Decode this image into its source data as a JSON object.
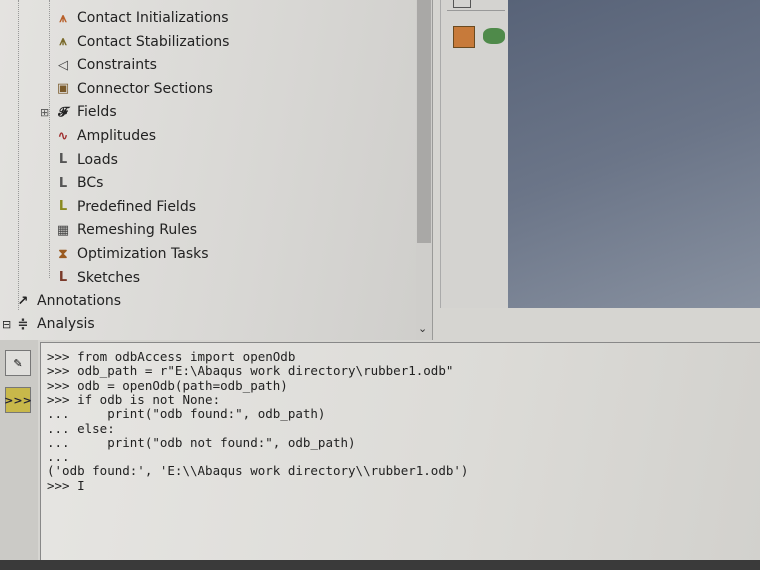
{
  "tree": {
    "items": [
      {
        "label": "Contact Initializations",
        "icon": "contact-init-icon"
      },
      {
        "label": "Contact Stabilizations",
        "icon": "contact-stab-icon"
      },
      {
        "label": "Constraints",
        "icon": "constraints-icon"
      },
      {
        "label": "Connector Sections",
        "icon": "connector-sections-icon"
      },
      {
        "label": "Fields",
        "icon": "fields-icon",
        "expand": "⊞"
      },
      {
        "label": "Amplitudes",
        "icon": "amplitudes-icon"
      },
      {
        "label": "Loads",
        "icon": "loads-icon"
      },
      {
        "label": "BCs",
        "icon": "bcs-icon"
      },
      {
        "label": "Predefined Fields",
        "icon": "predefined-fields-icon"
      },
      {
        "label": "Remeshing Rules",
        "icon": "remeshing-rules-icon"
      },
      {
        "label": "Optimization Tasks",
        "icon": "optimization-tasks-icon"
      },
      {
        "label": "Sketches",
        "icon": "sketches-icon"
      }
    ],
    "annotations": "Annotations",
    "analysis": "Analysis",
    "analysis_expand": "⊟"
  },
  "console": {
    "prompt_button": ">>>",
    "lines": [
      ">>> from odbAccess import openOdb",
      ">>> odb_path = r\"E:\\Abaqus work directory\\rubber1.odb\"",
      ">>> odb = openOdb(path=odb_path)",
      ">>> if odb is not None:",
      "...     print(\"odb found:\", odb_path)",
      "... else:",
      "...     print(\"odb not found:\", odb_path)",
      "...",
      "('odb found:', 'E:\\\\Abaqus work directory\\\\rubber1.odb')",
      ">>> I"
    ]
  },
  "colors": {
    "viewport": "#66708a",
    "prompt_button": "#c8b84a"
  }
}
